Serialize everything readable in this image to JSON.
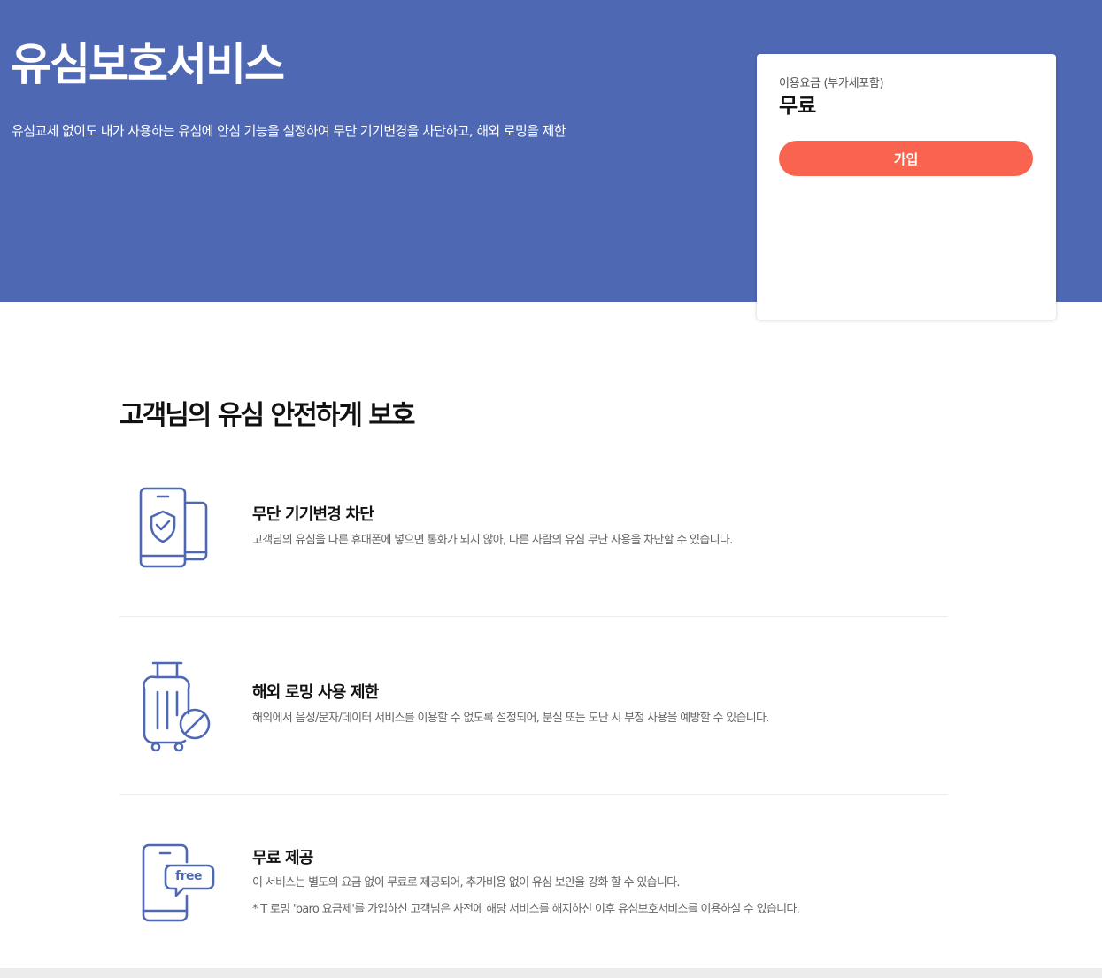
{
  "hero": {
    "title": "유심보호서비스",
    "description": "유심교체 없이도 내가 사용하는 유심에 안심 기능을 설정하여 무단 기기변경을 차단하고, 해외 로밍을 제한"
  },
  "price_card": {
    "label": "이용요금 (부가세포함)",
    "value": "무료",
    "join_label": "가입"
  },
  "section": {
    "title": "고객님의 유심 안전하게 보호"
  },
  "features": [
    {
      "icon": "phone-shield-icon",
      "title": "무단 기기변경 차단",
      "description": "고객님의 유심을 다른 휴대폰에 넣으면 통화가 되지 않아, 다른 사람의 유심 무단 사용을 차단할 수 있습니다."
    },
    {
      "icon": "suitcase-blocked-icon",
      "title": "해외 로밍 사용 제한",
      "description": "해외에서 음성/문자/데이터 서비스를 이용할 수 없도록 설정되어, 분실 또는 도난 시 부정 사용을 예방할 수 있습니다."
    },
    {
      "icon": "phone-free-icon",
      "icon_text": "free",
      "title": "무료 제공",
      "description": "이 서비스는 별도의 요금 없이 무료로 제공되어, 추가비용 없이 유심 보안을 강화 할 수 있습니다.",
      "note": "* T 로밍 'baro 요금제'를 가입하신 고객님은 사전에 해당 서비스를 해지하신 이후 유심보호서비스를 이용하실 수 있습니다."
    }
  ],
  "colors": {
    "hero_bg": "#4f68b4",
    "accent_button": "#f86450",
    "icon_stroke": "#4f68b4"
  }
}
